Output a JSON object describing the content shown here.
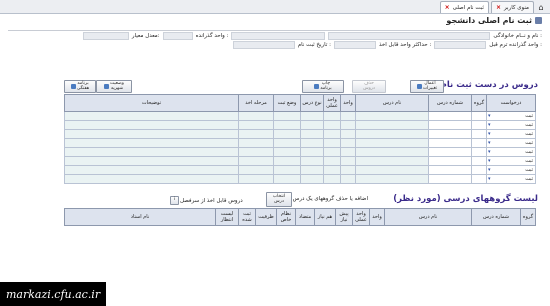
{
  "tabs": [
    {
      "label": "منوی کاربر",
      "active": false
    },
    {
      "label": "ثبت نام اصلی",
      "active": true
    }
  ],
  "page_title": "ثبت نام اصلی دانشجو",
  "info": {
    "name_label": "نام و نــام خانوادگی :",
    "unit_label": "واحد گذرانده :",
    "avg_label": "معدل معیار:",
    "passed_units_label": "واحد گذرانده ترم قبل :",
    "max_units_label": "حداکثر واحد قابل اخذ :",
    "reg_date_label": "تاریخ ثبت نام :"
  },
  "section1": {
    "title": "دروس در دست ثبت نام",
    "buttons": {
      "back": "اعمال\nتغییرات",
      "delete": "حذف\nدروس",
      "print": "چاپ\nبرنامه",
      "status": "وضعیت\nشهریه",
      "tuition": "پرداخت\nشهریه",
      "online": "برنامه\nهفتگی"
    },
    "headers": [
      "درخواست",
      "گروه",
      "شماره درس",
      "نام درس",
      "واحد",
      "واحد عملی",
      "نوع درس",
      "وضع ثبت",
      "مرحله اخذ",
      "توضیحات"
    ],
    "rows": [
      "ثبت",
      "ثبت",
      "ثبت",
      "ثبت",
      "ثبت",
      "ثبت",
      "ثبت",
      "ثبت"
    ]
  },
  "section2": {
    "title": "لیست گروههای درسی (مورد نظر)",
    "add_remove_label": "اضافه یا حذف گروههای یک درس",
    "sarfasl_button": "انتخاب\nدرس",
    "courses_label": "دروس قابل اخذ از سرفصل",
    "info_icon": "info-icon",
    "headers": [
      "گروه",
      "شماره درس",
      "نام درس",
      "واحد",
      "واحد عملی",
      "پیش نیاز",
      "هم نیاز",
      "متضاد",
      "نظام خاص",
      "ظرفیت",
      "ثبت شده",
      "لیست انتظار",
      "نام استاد"
    ]
  },
  "footer_text": "markazi.cfu.ac.ir"
}
